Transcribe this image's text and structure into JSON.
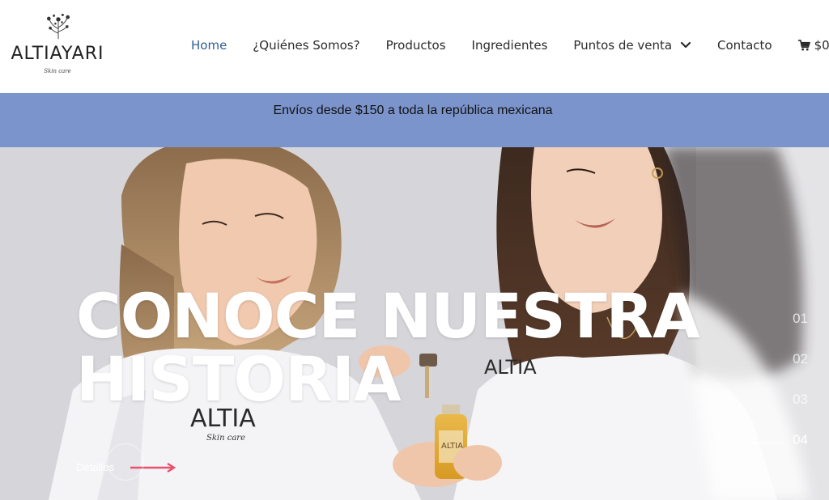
{
  "header": {
    "logo": {
      "wordmark": "ALTIAYARI",
      "tagline": "Skin care"
    },
    "nav": [
      {
        "label": "Home",
        "active": true
      },
      {
        "label": "¿Quiénes Somos?"
      },
      {
        "label": "Productos"
      },
      {
        "label": "Ingredientes"
      },
      {
        "label": "Puntos de venta",
        "has_dropdown": true
      },
      {
        "label": "Contacto"
      }
    ],
    "cart": {
      "label": "$0",
      "icon": "cart-icon"
    },
    "accent_color": "#2d5f9a"
  },
  "banner": {
    "text": "Envíos desde $150 a toda la república mexicana",
    "background": "#7b94cc"
  },
  "hero": {
    "title_line1": "CONOCE NUESTRA",
    "title_line2": "HISTORIA",
    "details_label": "Detalles",
    "arrow_color": "#e8506e",
    "slides": [
      "01",
      "02",
      "03",
      "04"
    ],
    "active_slide": "04",
    "photo": {
      "shirt_print": "ALTIA",
      "shirt_script": "Skin care",
      "bottle_label": "ALTIA"
    }
  }
}
